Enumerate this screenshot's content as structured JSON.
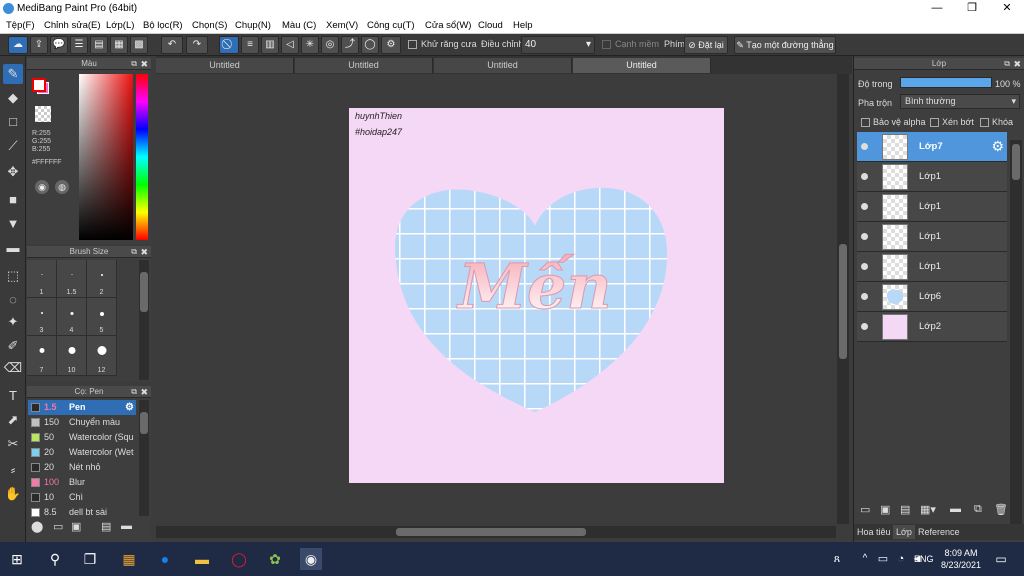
{
  "window": {
    "title": "MediBang Paint Pro (64bit)",
    "minimize": "—",
    "maximize": "❐",
    "close": "✕"
  },
  "menu": [
    "Tệp(F)",
    "Chỉnh sửa(E)",
    "Lớp(L)",
    "Bộ lọc(R)",
    "Chọn(S)",
    "Chụp(N)",
    "Màu (C)",
    "Xem(V)",
    "Công cụ(T)",
    "Cửa sổ(W)",
    "Cloud",
    "Help"
  ],
  "toolbar": {
    "antialias_label": "Khử răng cưa",
    "adjust_label": "Điều chỉnh",
    "adjust_value": "40",
    "edge_label": "Cạnh mềm",
    "key_label": "Phím",
    "cancel_label": "Đặt lại",
    "straight_label": "Tạo một đường thẳng"
  },
  "tabs": [
    "Untitled",
    "Untitled",
    "Untitled",
    "Untitled"
  ],
  "color_panel": {
    "title": "Màu",
    "r": "R:255",
    "g": "G:255",
    "b": "B:255",
    "hex": "#FFFFFF"
  },
  "brush_size_panel": {
    "title": "Brush Size",
    "sizes": [
      "1",
      "1.5",
      "2",
      "3",
      "4",
      "5",
      "7",
      "10",
      "12"
    ]
  },
  "pen_panel": {
    "title": "Cọ: Pen",
    "brushes": [
      {
        "size": "1.5",
        "name": "Pen",
        "color": "#2a2a2a"
      },
      {
        "size": "150",
        "name": "Chuyển màu",
        "color": "#c0c0c0"
      },
      {
        "size": "50",
        "name": "Watercolor (Squ",
        "color": "#b7e85a"
      },
      {
        "size": "20",
        "name": "Watercolor (Wet",
        "color": "#7ad0f0"
      },
      {
        "size": "20",
        "name": "Nét nhỏ",
        "color": "#2a2a2a"
      },
      {
        "size": "100",
        "name": "Blur",
        "color": "#f07aa8"
      },
      {
        "size": "10",
        "name": "Chì",
        "color": "#2a2a2a"
      },
      {
        "size": "8.5",
        "name": "dell bt sài",
        "color": "#ffffff"
      }
    ]
  },
  "canvas_text": {
    "line1": "huynhThien",
    "line2": "#hoidap247",
    "art": "Mến"
  },
  "layer_panel": {
    "title": "Lớp",
    "opacity_label": "Độ trong",
    "opacity_value": "100 %",
    "blend_label": "Pha trộn",
    "blend_value": "Bình thường",
    "protect_alpha": "Bảo vệ alpha",
    "clipping": "Xén bớt",
    "lock": "Khóa",
    "layers": [
      "Lớp7",
      "Lớp1",
      "Lớp1",
      "Lớp1",
      "Lớp1",
      "Lớp6",
      "Lớp2"
    ],
    "bottom_tabs": [
      "Hoa tiêu",
      "Lớp",
      "Reference"
    ]
  },
  "taskbar": {
    "time": "8:09 AM",
    "date": "8/23/2021",
    "lang": "ENG"
  },
  "colors": {
    "accent": "#2f6db5",
    "canvas": "#f4d8f6",
    "heart": "#b8d8f8"
  }
}
